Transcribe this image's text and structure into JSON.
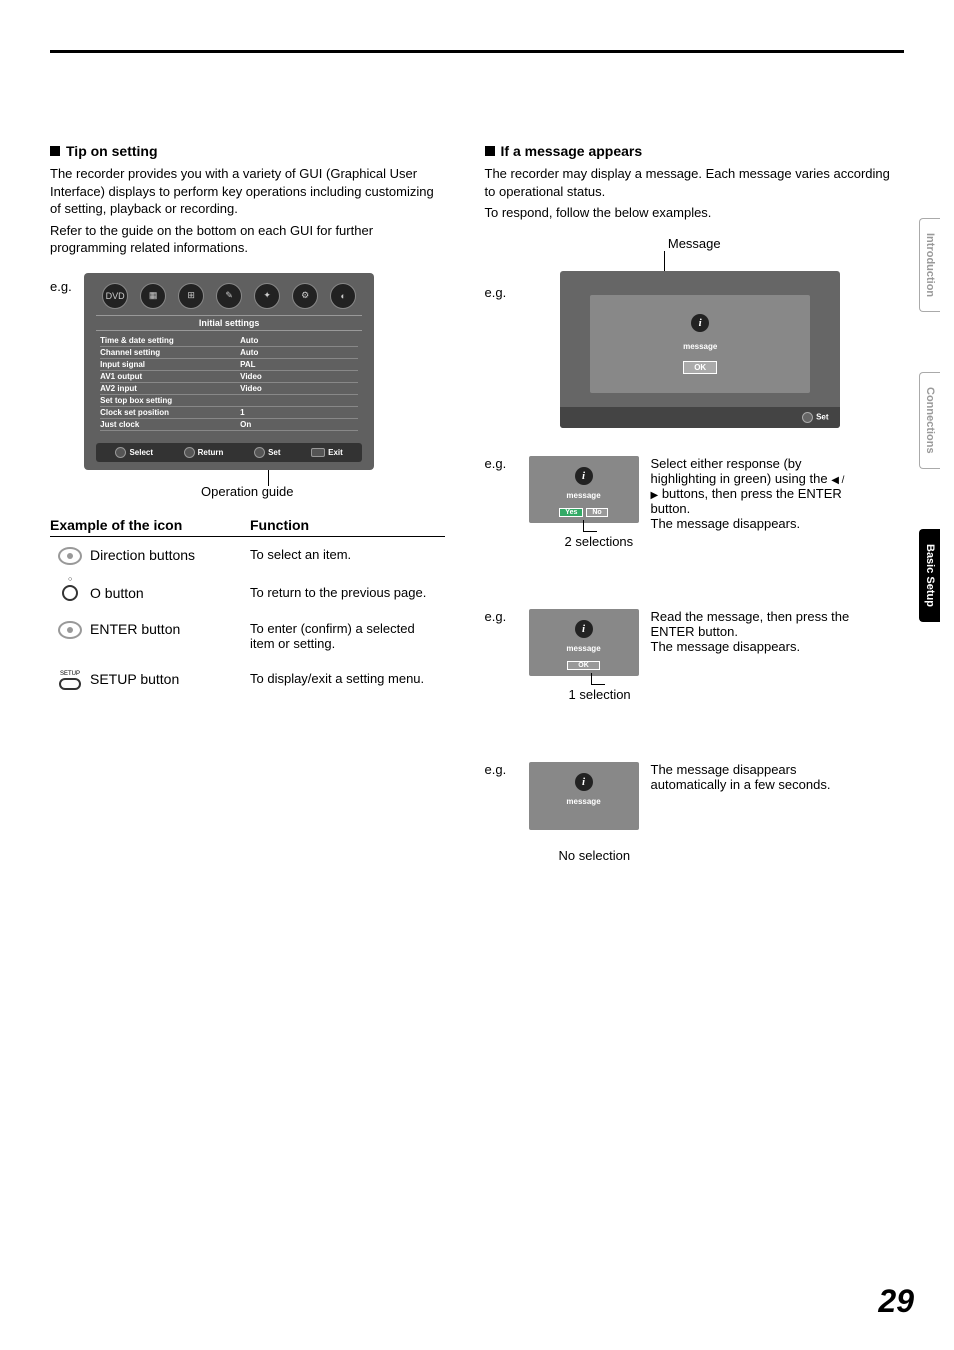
{
  "page_number": "29",
  "left": {
    "title": "Tip on setting",
    "p1": "The recorder provides you with a variety of GUI (Graphical User Interface) displays to perform key operations including customizing of setting, playback or recording.",
    "p2": "Refer to the guide on the bottom on each GUI for further programming related informations.",
    "eg": "e.g.",
    "gui": {
      "init_title": "Initial settings",
      "rows": [
        {
          "k": "Time & date setting",
          "v": "Auto"
        },
        {
          "k": "Channel setting",
          "v": "Auto"
        },
        {
          "k": "Input signal",
          "v": "PAL"
        },
        {
          "k": "AV1 output",
          "v": "Video"
        },
        {
          "k": "AV2 input",
          "v": "Video"
        },
        {
          "k": "Set top box setting",
          "v": ""
        },
        {
          "k": "Clock set position",
          "v": "1"
        },
        {
          "k": "Just clock",
          "v": "On"
        }
      ],
      "ops": {
        "select": "Select",
        "return": "Return",
        "set": "Set",
        "exit": "Exit"
      }
    },
    "op_guide": "Operation guide",
    "table": {
      "h1": "Example of the icon",
      "h2": "Function",
      "rows": [
        {
          "name": "Direction buttons",
          "func": "To select an item."
        },
        {
          "name": "O button",
          "func": "To return to the previous page."
        },
        {
          "name": "ENTER button",
          "func": "To enter (confirm) a selected item or setting."
        },
        {
          "name": "SETUP button",
          "func": "To display/exit a setting menu.",
          "label": "SETUP"
        }
      ]
    }
  },
  "right": {
    "title": "If a message appears",
    "p1": "The recorder may display a message. Each message varies according to operational status.",
    "p2": "To respond, follow the below examples.",
    "message_label": "Message",
    "eg": "e.g.",
    "dialog": {
      "msg": "message",
      "ok": "OK",
      "set": "Set"
    },
    "ex2": {
      "msg": "message",
      "yes": "Yes",
      "no": "No",
      "desc1": "Select either response (by highlighting in green) using the ",
      "desc2": " buttons, then press the ENTER button.",
      "desc3": "The message disappears.",
      "caption": "2 selections"
    },
    "ex3": {
      "msg": "message",
      "ok": "OK",
      "desc1": "Read the message, then press the ENTER button.",
      "desc2": "The message disappears.",
      "caption": "1 selection"
    },
    "ex4": {
      "msg": "message",
      "desc": "The message disappears automatically in a few seconds.",
      "caption": "No selection"
    }
  },
  "tabs": [
    "Introduction",
    "Connections",
    "Basic Setup"
  ]
}
